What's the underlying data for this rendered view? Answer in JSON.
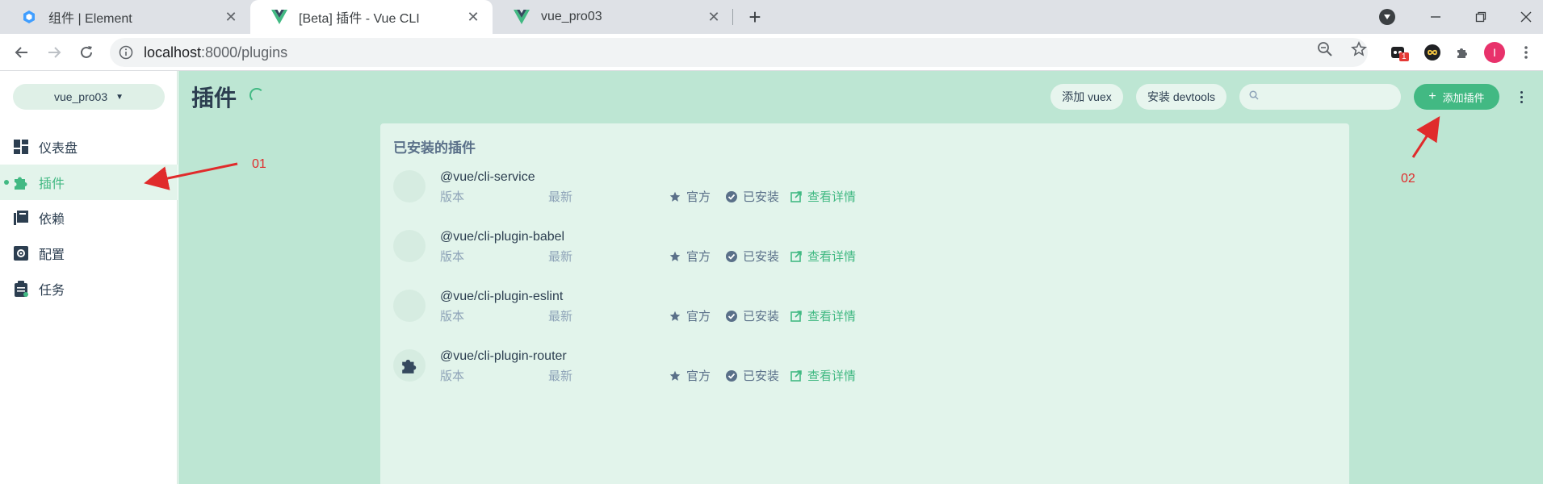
{
  "browser": {
    "tabs": [
      {
        "title": "组件 | Element",
        "close": "✕"
      },
      {
        "title": "[Beta] 插件 - Vue CLI",
        "close": "✕"
      },
      {
        "title": "vue_pro03",
        "close": "✕"
      }
    ],
    "new_tab": "+",
    "url_host": "localhost",
    "url_path": ":8000/plugins",
    "profile_initial": "I",
    "extension_badge": "1"
  },
  "sidebar": {
    "project": "vue_pro03",
    "items": [
      {
        "label": "仪表盘",
        "icon": "dashboard-icon"
      },
      {
        "label": "插件",
        "icon": "puzzle-icon"
      },
      {
        "label": "依赖",
        "icon": "library-icon"
      },
      {
        "label": "配置",
        "icon": "settings-icon"
      },
      {
        "label": "任务",
        "icon": "clipboard-icon"
      }
    ],
    "active_index": 1
  },
  "main": {
    "title": "插件",
    "toolbar": {
      "add_vuex": "添加 vuex",
      "install_devtools": "安装 devtools",
      "search_placeholder": "",
      "add_plugin": "添加插件"
    },
    "panel_title": "已安装的插件",
    "plugins": [
      {
        "name": "@vue/cli-service",
        "version_label": "版本",
        "latest_label": "最新",
        "official": "官方",
        "installed": "已安装",
        "details": "查看详情",
        "has_logo": false
      },
      {
        "name": "@vue/cli-plugin-babel",
        "version_label": "版本",
        "latest_label": "最新",
        "official": "官方",
        "installed": "已安装",
        "details": "查看详情",
        "has_logo": false
      },
      {
        "name": "@vue/cli-plugin-eslint",
        "version_label": "版本",
        "latest_label": "最新",
        "official": "官方",
        "installed": "已安装",
        "details": "查看详情",
        "has_logo": false
      },
      {
        "name": "@vue/cli-plugin-router",
        "version_label": "版本",
        "latest_label": "最新",
        "official": "官方",
        "installed": "已安装",
        "details": "查看详情",
        "has_logo": true
      }
    ]
  },
  "annotations": {
    "label_1": "01",
    "label_2": "02",
    "color": "#e02b2b"
  },
  "colors": {
    "accent": "#42b983",
    "main_bg": "#bde6d3",
    "panel_bg": "#e2f4eb"
  }
}
